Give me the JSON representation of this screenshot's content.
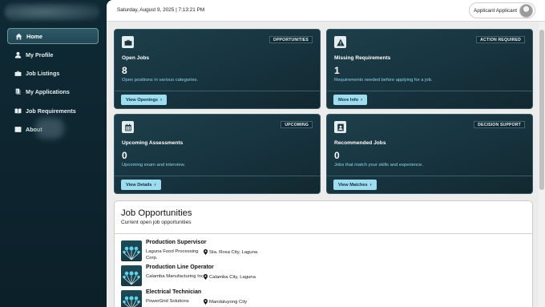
{
  "sidebar": {
    "items": [
      {
        "label": "Home",
        "icon": "home-icon",
        "active": true
      },
      {
        "label": "My Profile",
        "icon": "user-icon"
      },
      {
        "label": "Job Listings",
        "icon": "briefcase-icon"
      },
      {
        "label": "My Applications",
        "icon": "documents-icon"
      },
      {
        "label": "Job Requirements",
        "icon": "book-icon"
      },
      {
        "label": "About",
        "icon": "info-icon"
      }
    ]
  },
  "header": {
    "datetime": "Saturday, August 9, 2025 | 7:13:21 PM",
    "user_name": "Applicant Applicant"
  },
  "cards": [
    {
      "icon": "briefcase-icon",
      "tag": "OPPORTUNITIES",
      "title": "Open Jobs",
      "value": "8",
      "desc": "Open positions in various categories.",
      "button": "View Openings"
    },
    {
      "icon": "warning-icon",
      "tag": "ACTION REQUIRED",
      "title": "Missing Requirements",
      "value": "1",
      "desc": "Requirements needed before applying for a job.",
      "button": "More Info"
    },
    {
      "icon": "calendar-icon",
      "tag": "UPCOMING",
      "title": "Upcoming Assessments",
      "value": "0",
      "desc": "Upcoming exam and interview.",
      "button": "View Details"
    },
    {
      "icon": "id-badge-icon",
      "tag": "DECISION SUPPORT",
      "title": "Recommended Jobs",
      "value": "0",
      "desc": "Jobs that match your skills and experience.",
      "button": "View Matches"
    }
  ],
  "jobs": {
    "title": "Job Opportunities",
    "subtitle": "Current open job opportunities",
    "items": [
      {
        "title": "Production Supervisor",
        "company": "Laguna Food Processing Corp.",
        "location": "Sta. Rosa City, Laguna"
      },
      {
        "title": "Production Line Operator",
        "company": "Calamba Manufacturing Inc.",
        "location": "Calamba City, Laguna"
      },
      {
        "title": "Electrical Technician",
        "company": "PowerGrid Solutions",
        "location": "Mandaluyong City"
      }
    ]
  },
  "colors": {
    "sidebar_bg": "#0f2a35",
    "card_bg": "#17333e",
    "accent": "#9edcf0",
    "desc_text": "#8fd6ec"
  }
}
